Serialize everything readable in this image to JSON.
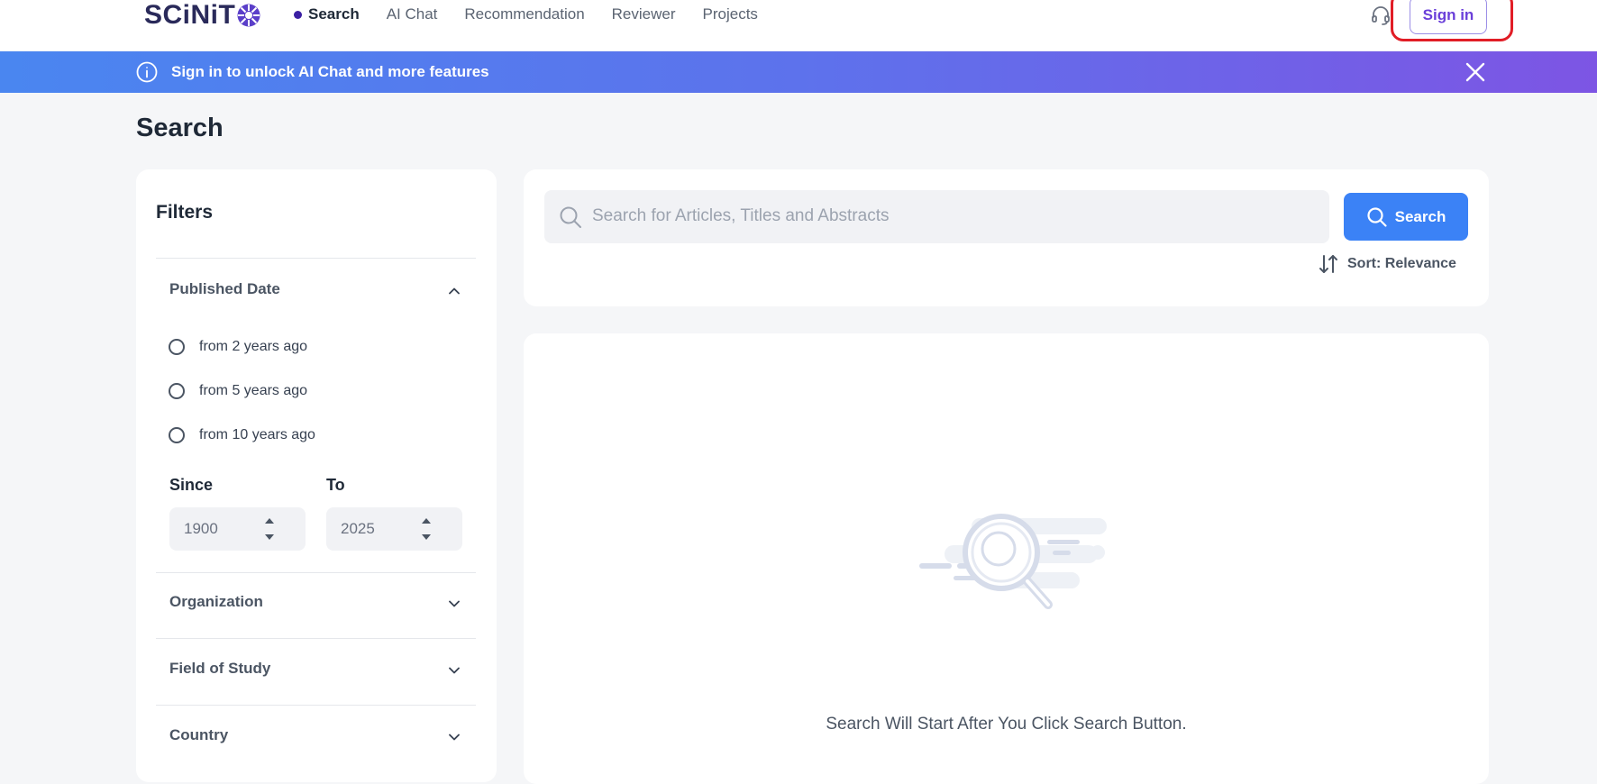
{
  "header": {
    "logo_text": "SCiNiT",
    "nav": [
      {
        "label": "Search",
        "active": true
      },
      {
        "label": "AI Chat",
        "active": false
      },
      {
        "label": "Recommendation",
        "active": false
      },
      {
        "label": "Reviewer",
        "active": false
      },
      {
        "label": "Projects",
        "active": false
      }
    ],
    "support_icon": "headset-icon",
    "signin_label": "Sign in"
  },
  "banner": {
    "info_icon": "info-icon",
    "text": "Sign in to unlock AI Chat and more features",
    "close_icon": "close-icon"
  },
  "page": {
    "title": "Search"
  },
  "filters": {
    "title": "Filters",
    "published_date": {
      "label": "Published Date",
      "expanded": true,
      "options": [
        "from 2 years ago",
        "from 5 years ago",
        "from 10 years ago"
      ],
      "since_label": "Since",
      "to_label": "To",
      "since_value": "1900",
      "to_value": "2025"
    },
    "sections": [
      {
        "label": "Organization",
        "expanded": false
      },
      {
        "label": "Field of Study",
        "expanded": false
      },
      {
        "label": "Country",
        "expanded": false
      }
    ]
  },
  "search": {
    "placeholder": "Search for Articles, Titles and Abstracts",
    "button_label": "Search",
    "sort_label": "Sort: Relevance"
  },
  "results": {
    "empty_message": "Search Will Start After You Click Search Button."
  },
  "colors": {
    "accent": "#3b82f6",
    "brand_purple": "#6a3fd9",
    "banner_start": "#4a86f0",
    "banner_end": "#7d55e4",
    "highlight": "#e11d26"
  }
}
